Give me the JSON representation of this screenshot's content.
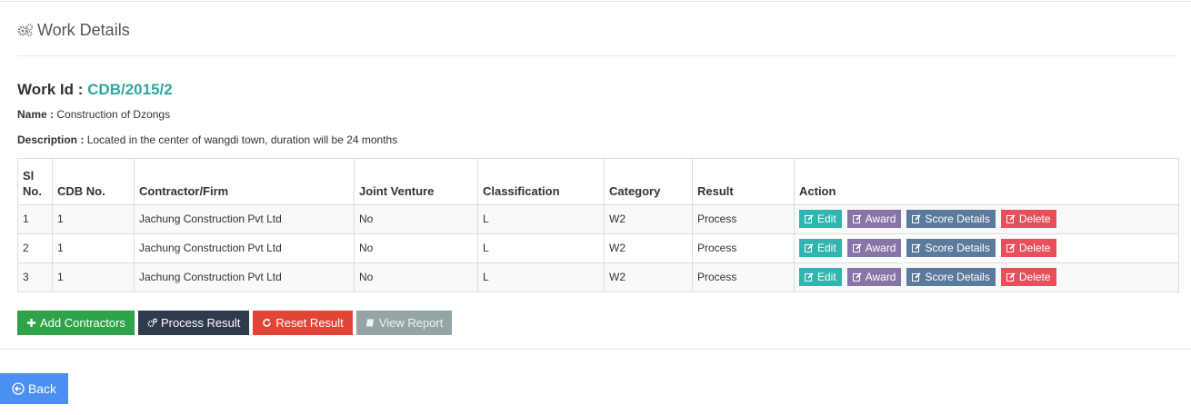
{
  "header": {
    "title": "Work Details",
    "icon": "gears-icon"
  },
  "work": {
    "id_label": "Work Id :",
    "id_value": "CDB/2015/2",
    "name_label": "Name :",
    "name_value": "Construction of Dzongs",
    "desc_label": "Description :",
    "desc_value": "Located in the center of wangdi town, duration will be 24 months"
  },
  "table": {
    "columns": [
      "Sl No.",
      "CDB No.",
      "Contractor/Firm",
      "Joint Venture",
      "Classification",
      "Category",
      "Result",
      "Action"
    ],
    "rows": [
      {
        "sl": "1",
        "cdb": "1",
        "firm": "Jachung Construction Pvt Ltd",
        "jv": "No",
        "class": "L",
        "category": "W2",
        "result": "Process"
      },
      {
        "sl": "2",
        "cdb": "1",
        "firm": "Jachung Construction Pvt Ltd",
        "jv": "No",
        "class": "L",
        "category": "W2",
        "result": "Process"
      },
      {
        "sl": "3",
        "cdb": "1",
        "firm": "Jachung Construction Pvt Ltd",
        "jv": "No",
        "class": "L",
        "category": "W2",
        "result": "Process"
      }
    ],
    "row_actions": {
      "edit": "Edit",
      "award": "Award",
      "score": "Score Details",
      "delete": "Delete"
    }
  },
  "buttons": {
    "add": "Add Contractors",
    "process": "Process Result",
    "reset": "Reset Result",
    "view": "View Report",
    "back": "Back"
  },
  "colors": {
    "id_accent": "#32a4a0",
    "edit": "#32b4b0",
    "award": "#8775a7",
    "score": "#5c7a9c",
    "delete": "#e7505a",
    "add": "#2ea34a",
    "process": "#2f3b4c",
    "reset": "#e04535",
    "view": "#95a5a6",
    "back": "#4c8ff2"
  }
}
